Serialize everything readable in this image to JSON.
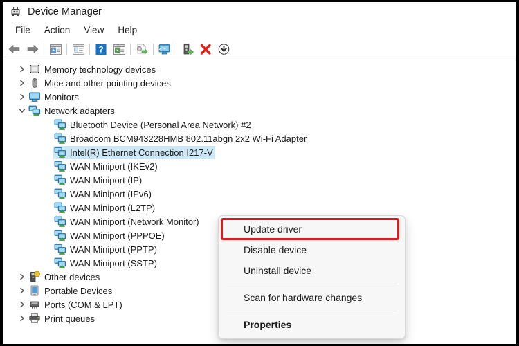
{
  "window": {
    "title": "Device Manager",
    "app_icon": "device-manager-icon"
  },
  "menubar": {
    "items": [
      {
        "label": "File"
      },
      {
        "label": "Action"
      },
      {
        "label": "View"
      },
      {
        "label": "Help"
      }
    ]
  },
  "toolbar": {
    "buttons": [
      {
        "icon": "back-arrow-icon",
        "title": "Back"
      },
      {
        "icon": "forward-arrow-icon",
        "title": "Forward"
      },
      {
        "sep": true
      },
      {
        "icon": "console-tree-icon",
        "title": "Show/Hide Console Tree"
      },
      {
        "sep": true
      },
      {
        "icon": "properties-window-icon",
        "title": "Properties"
      },
      {
        "sep": true
      },
      {
        "icon": "help-question-icon",
        "title": "Help"
      },
      {
        "icon": "action-menu-icon",
        "title": "Action Menu"
      },
      {
        "sep": true
      },
      {
        "icon": "update-driver-icon",
        "title": "Update Driver Software"
      },
      {
        "sep": true
      },
      {
        "icon": "scan-hardware-icon",
        "title": "Scan for hardware changes"
      },
      {
        "sep": true
      },
      {
        "icon": "enable-device-icon",
        "title": "Enable device"
      },
      {
        "icon": "uninstall-device-icon",
        "title": "Uninstall device"
      },
      {
        "icon": "disable-device-icon",
        "title": "Disable device"
      }
    ]
  },
  "tree": {
    "rows": [
      {
        "label": "Memory technology devices",
        "level": 0,
        "expander": "collapsed",
        "icon": "memory-technology-icon",
        "selected": false
      },
      {
        "label": "Mice and other pointing devices",
        "level": 0,
        "expander": "collapsed",
        "icon": "mouse-icon",
        "selected": false
      },
      {
        "label": "Monitors",
        "level": 0,
        "expander": "collapsed",
        "icon": "monitor-icon",
        "selected": false
      },
      {
        "label": "Network adapters",
        "level": 0,
        "expander": "expanded",
        "icon": "network-adapter-icon",
        "selected": false
      },
      {
        "label": "Bluetooth Device (Personal Area Network) #2",
        "level": 1,
        "expander": "none",
        "icon": "network-adapter-icon",
        "selected": false
      },
      {
        "label": "Broadcom BCM943228HMB 802.11abgn 2x2 Wi-Fi Adapter",
        "level": 1,
        "expander": "none",
        "icon": "network-adapter-icon",
        "selected": false
      },
      {
        "label": "Intel(R) Ethernet Connection I217-V",
        "level": 1,
        "expander": "none",
        "icon": "network-adapter-icon",
        "selected": true
      },
      {
        "label": "WAN Miniport (IKEv2)",
        "level": 1,
        "expander": "none",
        "icon": "network-adapter-icon",
        "selected": false
      },
      {
        "label": "WAN Miniport (IP)",
        "level": 1,
        "expander": "none",
        "icon": "network-adapter-icon",
        "selected": false
      },
      {
        "label": "WAN Miniport (IPv6)",
        "level": 1,
        "expander": "none",
        "icon": "network-adapter-icon",
        "selected": false
      },
      {
        "label": "WAN Miniport (L2TP)",
        "level": 1,
        "expander": "none",
        "icon": "network-adapter-icon",
        "selected": false
      },
      {
        "label": "WAN Miniport (Network Monitor)",
        "level": 1,
        "expander": "none",
        "icon": "network-adapter-icon",
        "selected": false
      },
      {
        "label": "WAN Miniport (PPPOE)",
        "level": 1,
        "expander": "none",
        "icon": "network-adapter-icon",
        "selected": false
      },
      {
        "label": "WAN Miniport (PPTP)",
        "level": 1,
        "expander": "none",
        "icon": "network-adapter-icon",
        "selected": false
      },
      {
        "label": "WAN Miniport (SSTP)",
        "level": 1,
        "expander": "none",
        "icon": "network-adapter-icon",
        "selected": false
      },
      {
        "label": "Other devices",
        "level": 0,
        "expander": "collapsed",
        "icon": "other-devices-warning-icon",
        "selected": false
      },
      {
        "label": "Portable Devices",
        "level": 0,
        "expander": "collapsed",
        "icon": "portable-device-icon",
        "selected": false
      },
      {
        "label": "Ports (COM & LPT)",
        "level": 0,
        "expander": "collapsed",
        "icon": "ports-icon",
        "selected": false
      },
      {
        "label": "Print queues",
        "level": 0,
        "expander": "collapsed",
        "icon": "printer-icon",
        "selected": false
      }
    ]
  },
  "context_menu": {
    "items": [
      {
        "label": "Update driver",
        "bold": false,
        "highlighted": true
      },
      {
        "label": "Disable device",
        "bold": false,
        "highlighted": false
      },
      {
        "label": "Uninstall device",
        "bold": false,
        "highlighted": false
      },
      {
        "separator": true
      },
      {
        "label": "Scan for hardware changes",
        "bold": false,
        "highlighted": false
      },
      {
        "separator": true
      },
      {
        "label": "Properties",
        "bold": true,
        "highlighted": false
      }
    ]
  },
  "colors": {
    "selection_blue": "#cde8f7",
    "highlight_red": "#e01b1b",
    "menu_background": "#f7f7f7",
    "window_background": "#ffffff",
    "text": "#1b1b1b"
  }
}
